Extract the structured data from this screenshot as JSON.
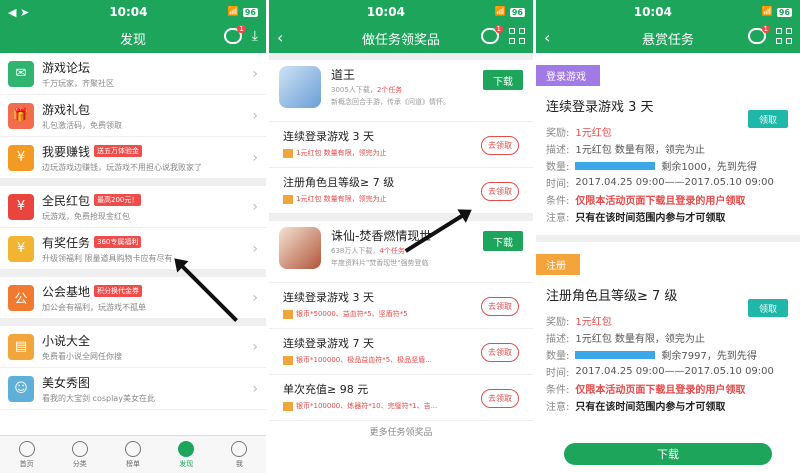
{
  "status": {
    "time": "10:04",
    "battery": "96"
  },
  "p1": {
    "title": "发现",
    "items": [
      {
        "title": "游戏论坛",
        "sub": "千万玩家，齐聚社区",
        "color": "#2fb570",
        "icon": "forum-icon"
      },
      {
        "title": "游戏礼包",
        "sub": "礼包激活码，免费领取",
        "color": "#f26d4d",
        "icon": "gift-icon"
      },
      {
        "title": "我要赚钱",
        "sub": "边玩游戏边赚钱，玩游戏不用担心说我败家了",
        "tag": "送五万体验金",
        "color": "#f39a24",
        "icon": "money-icon"
      },
      {
        "title": "全民红包",
        "sub": "玩游戏，免费抢现金红包",
        "tag": "最高200元！",
        "color": "#e9453e",
        "icon": "redpacket-icon"
      },
      {
        "title": "有奖任务",
        "sub": "升级领福利 限量道具购物卡应有尽有",
        "tag": "360专属福利",
        "color": "#f2b531",
        "icon": "task-icon"
      },
      {
        "title": "公会基地",
        "sub": "加公会有福利，玩游戏不孤单",
        "tag": "积分换代金券",
        "color": "#f07a2f",
        "icon": "guild-icon"
      },
      {
        "title": "小说大全",
        "sub": "免费看小说全网任你搜",
        "color": "#f2a53a",
        "icon": "book-icon"
      },
      {
        "title": "美女秀图",
        "sub": "看我的大宝剑 cosplay美女在此",
        "color": "#5fb0d8",
        "icon": "photo-icon"
      }
    ],
    "tabs": [
      "首页",
      "分类",
      "榜单",
      "发现",
      "我"
    ]
  },
  "p2": {
    "title": "做任务领奖品",
    "games": [
      {
        "name": "道王",
        "meta_a": "3005人下载，",
        "meta_b": "2个任务",
        "desc": "新概念回合手游，传承《问道》情怀。",
        "dl": "下载",
        "tasks": [
          {
            "title": "连续登录游戏 3 天",
            "reward": "1元红包 数量有限，领完为止",
            "claim": "去领取"
          },
          {
            "title": "注册角色且等级≥ 7 级",
            "reward": "1元红包 数量有限，领完为止",
            "claim": "去领取"
          }
        ]
      },
      {
        "name": "诛仙-焚香燃情现世",
        "meta_a": "638万人下载，",
        "meta_b": "4个任务",
        "desc": "年度资料片\"焚香现世\"强势登临",
        "dl": "下载",
        "tasks": [
          {
            "title": "连续登录游戏 3 天",
            "reward": "银币*50000、益血符*5、坚盾符*5",
            "claim": "去领取"
          },
          {
            "title": "连续登录游戏 7 天",
            "reward": "银币*100000、极品益血符*5、极品坚盾...",
            "claim": "去领取"
          },
          {
            "title": "单次充值≥ 98 元",
            "reward": "银币*100000、炼器符*10、完璧符*1、吉...",
            "claim": "去领取"
          }
        ]
      }
    ],
    "footer": "更多任务领奖品"
  },
  "p3": {
    "title": "悬赏任务",
    "cards": [
      {
        "banner": "登录游戏",
        "bcolor": "#a07be6",
        "title": "连续登录游戏 3 天",
        "btn": "领取",
        "reward_k": "奖励:",
        "reward": "1元红包",
        "desc_k": "描述:",
        "desc": "1元红包 数量有限，领完为止",
        "qty_k": "数量:",
        "qty": "剩余1000，先到先得",
        "time_k": "时间:",
        "time": "2017.04.25 09:00——2017.05.10 09:00",
        "cond_k": "条件:",
        "cond": "仅限本活动页面下载且登录的用户领取",
        "note_k": "注意:",
        "note": "只有在该时间范围内参与才可领取"
      },
      {
        "banner": "注册",
        "bcolor": "#f5a33b",
        "title": "注册角色且等级≥ 7 级",
        "btn": "领取",
        "reward_k": "奖励:",
        "reward": "1元红包",
        "desc_k": "描述:",
        "desc": "1元红包 数量有限，领完为止",
        "qty_k": "数量:",
        "qty": "剩余7997，先到先得",
        "time_k": "时间:",
        "time": "2017.04.25 09:00——2017.05.10 09:00",
        "cond_k": "条件:",
        "cond": "仅限本活动页面下载且登录的用户领取",
        "note_k": "注意:",
        "note": "只有在该时间范围内参与才可领取"
      }
    ],
    "download": "下载"
  }
}
